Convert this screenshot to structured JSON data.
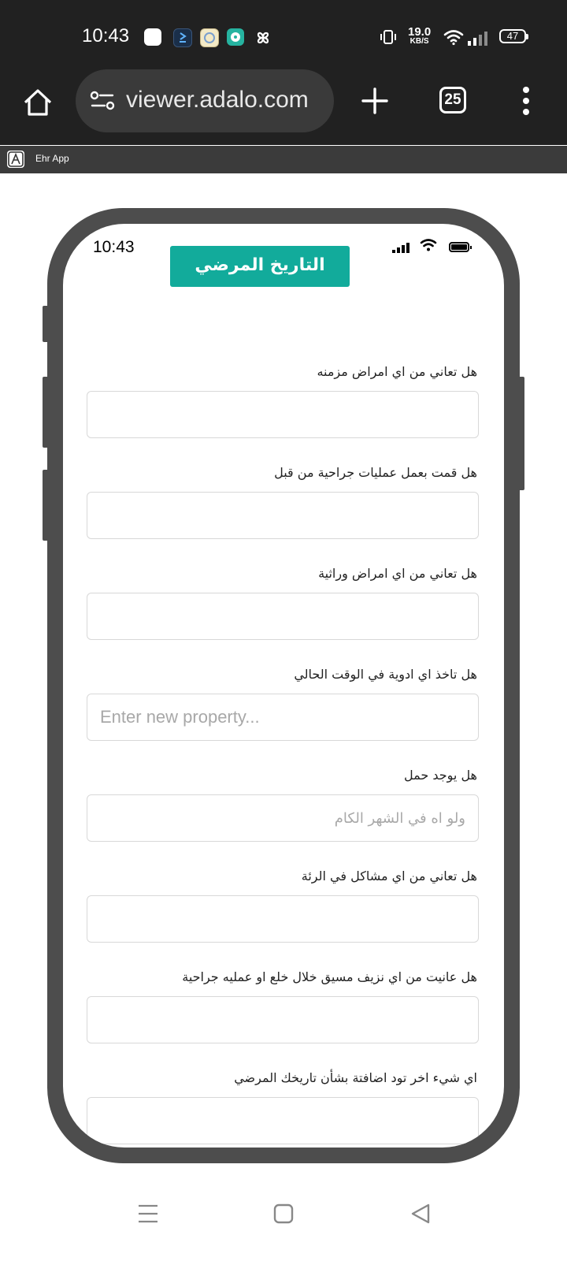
{
  "status_bar": {
    "time": "10:43",
    "net_speed_value": "19.0",
    "net_speed_unit": "KB/S",
    "battery": "47",
    "notification_icons": [
      "white-square-icon",
      "app-download-icon",
      "app-badge-icon",
      "chat-bubble-icon",
      "pinwheel-icon"
    ],
    "system_icons": [
      "vibrate-icon",
      "wifi-icon",
      "signal-icon",
      "battery-icon"
    ]
  },
  "browser": {
    "url": "viewer.adalo.com",
    "tab_count": "25"
  },
  "app_bar": {
    "app_name": "Ehr App"
  },
  "app_screen": {
    "status_time": "10:43",
    "title": "التاريخ المرضي",
    "title_bg_color": "#12ab9b",
    "questions": [
      {
        "label": "هل تعاني من اي امراض مزمنه",
        "placeholder": ""
      },
      {
        "label": "هل قمت بعمل عمليات جراحية من قبل",
        "placeholder": ""
      },
      {
        "label": "هل تعاني من اي امراض وراثية",
        "placeholder": ""
      },
      {
        "label": "هل تاخذ اي ادوية في الوقت الحالي",
        "placeholder": "Enter new property..."
      },
      {
        "label": "هل يوجد حمل",
        "placeholder": "ولو اه في الشهر الكام"
      },
      {
        "label": "هل تعاني من اي مشاكل في الرئة",
        "placeholder": ""
      },
      {
        "label": "هل عانيت من اي نزيف مسيق خلال خلع او عمليه جراحية",
        "placeholder": ""
      },
      {
        "label": "اي شيء اخر تود اضافتة بشأن تاريخك المرضي",
        "placeholder": ""
      }
    ]
  }
}
